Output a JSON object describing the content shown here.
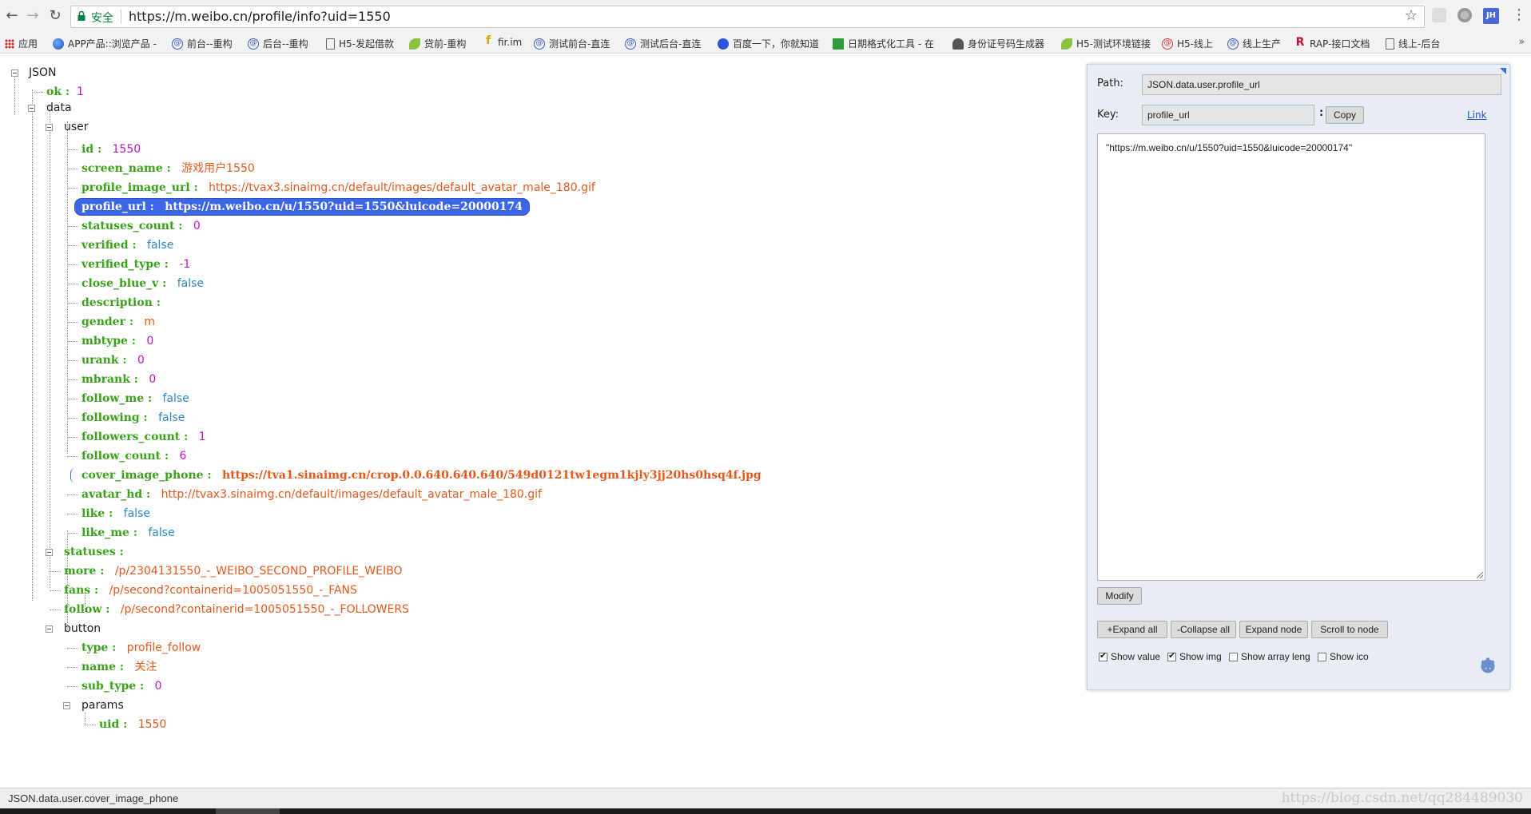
{
  "browser": {
    "secure_label": "安全",
    "url": "https://m.weibo.cn/profile/info?uid=1550",
    "profile_badge": "JH",
    "bookmarks": [
      {
        "label": "应用",
        "icon": "apps-grid-icon"
      },
      {
        "label": "APP产品::浏览产品 -",
        "icon": "globe-icon"
      },
      {
        "label": "前台--重构",
        "icon": "at-icon"
      },
      {
        "label": "后台--重构",
        "icon": "at-icon"
      },
      {
        "label": "H5-发起借款",
        "icon": "document-icon"
      },
      {
        "label": "贷前-重构",
        "icon": "leaf-icon"
      },
      {
        "label": "fir.im",
        "icon": "f-logo-icon"
      },
      {
        "label": "测试前台-直连",
        "icon": "at-icon"
      },
      {
        "label": "测试后台-直连",
        "icon": "at-icon"
      },
      {
        "label": "百度一下，你就知道",
        "icon": "paw-icon"
      },
      {
        "label": "日期格式化工具 - 在",
        "icon": "tool-icon"
      },
      {
        "label": "身份证号码生成器",
        "icon": "person-icon"
      },
      {
        "label": "H5-测试环境链接",
        "icon": "leaf-icon"
      },
      {
        "label": "H5-线上",
        "icon": "at-red-icon"
      },
      {
        "label": "线上生产",
        "icon": "at-icon"
      },
      {
        "label": "RAP-接口文档",
        "icon": "r-logo-icon"
      },
      {
        "label": "线上-后台",
        "icon": "document-icon"
      }
    ],
    "bookmarks_more": "»"
  },
  "tree": {
    "root": "JSON",
    "ok_key": "ok :",
    "ok_val": "1",
    "data_key": "data",
    "user_key": "user",
    "user": [
      {
        "key": "id :",
        "val": "1550",
        "type": "num"
      },
      {
        "key": "screen_name :",
        "val": "游戏用户1550",
        "type": "str"
      },
      {
        "key": "profile_image_url :",
        "val": "https://tvax3.sinaimg.cn/default/images/default_avatar_male_180.gif",
        "type": "str"
      },
      {
        "key": "profile_url :",
        "val": "https://m.weibo.cn/u/1550?uid=1550&luicode=20000174",
        "type": "str"
      },
      {
        "key": "statuses_count :",
        "val": "0",
        "type": "num"
      },
      {
        "key": "verified :",
        "val": "false",
        "type": "bool"
      },
      {
        "key": "verified_type :",
        "val": "-1",
        "type": "num"
      },
      {
        "key": "close_blue_v :",
        "val": "false",
        "type": "bool"
      },
      {
        "key": "description :",
        "val": "",
        "type": "str"
      },
      {
        "key": "gender :",
        "val": "m",
        "type": "str"
      },
      {
        "key": "mbtype :",
        "val": "0",
        "type": "num"
      },
      {
        "key": "urank :",
        "val": "0",
        "type": "num"
      },
      {
        "key": "mbrank :",
        "val": "0",
        "type": "num"
      },
      {
        "key": "follow_me :",
        "val": "false",
        "type": "bool"
      },
      {
        "key": "following :",
        "val": "false",
        "type": "bool"
      },
      {
        "key": "followers_count :",
        "val": "1",
        "type": "num"
      },
      {
        "key": "follow_count :",
        "val": "6",
        "type": "num"
      },
      {
        "key": "cover_image_phone :",
        "val": "https://tva1.sinaimg.cn/crop.0.0.640.640.640/549d0121tw1egm1kjly3jj20hs0hsq4f.jpg",
        "type": "str"
      },
      {
        "key": "avatar_hd :",
        "val": "http://tvax3.sinaimg.cn/default/images/default_avatar_male_180.gif",
        "type": "str"
      },
      {
        "key": "like :",
        "val": "false",
        "type": "bool"
      },
      {
        "key": "like_me :",
        "val": "false",
        "type": "bool"
      }
    ],
    "statuses_key": "statuses :",
    "more_key": "more :",
    "more_val": "/p/2304131550_-_WEIBO_SECOND_PROFILE_WEIBO",
    "fans_key": "fans :",
    "fans_val": "/p/second?containerid=1005051550_-_FANS",
    "follow_key": "follow :",
    "follow_val": "/p/second?containerid=1005051550_-_FOLLOWERS",
    "button_key": "button",
    "button": [
      {
        "key": "type :",
        "val": "profile_follow",
        "type": "str"
      },
      {
        "key": "name :",
        "val": "关注",
        "type": "str"
      },
      {
        "key": "sub_type :",
        "val": "0",
        "type": "num"
      }
    ],
    "params_key": "params",
    "uid_key": "uid :",
    "uid_val": "1550"
  },
  "panel": {
    "path_label": "Path:",
    "path_value": "JSON.data.user.profile_url",
    "key_label": "Key:",
    "key_value": "profile_url",
    "key_sep": ":",
    "copy_label": "Copy",
    "link_label": "Link",
    "value_text": "\"https://m.weibo.cn/u/1550?uid=1550&luicode=20000174\"",
    "modify_label": "Modify",
    "expand_all": "+Expand all",
    "collapse_all": "-Collapse all",
    "expand_node": "Expand node",
    "scroll_to_node": "Scroll to node",
    "show_value": "Show value",
    "show_img": "Show img",
    "show_array_leng": "Show array leng",
    "show_ico": "Show ico",
    "show_value_checked": true,
    "show_img_checked": true,
    "show_array_checked": false,
    "show_ico_checked": false
  },
  "status": {
    "path": "JSON.data.user.cover_image_phone",
    "watermark": "https://blog.csdn.net/qq284489030"
  }
}
